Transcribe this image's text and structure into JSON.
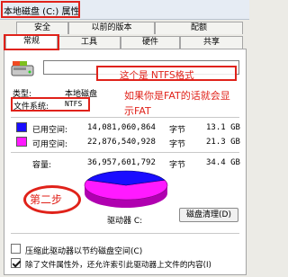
{
  "window": {
    "title": "本地磁盘 (C:) 属性"
  },
  "tabs": {
    "row1": [
      "安全",
      "以前的版本",
      "配额"
    ],
    "row2": [
      "常规",
      "工具",
      "硬件",
      "共享"
    ],
    "active": "常规"
  },
  "general": {
    "drive_name_value": "",
    "type_label": "类型:",
    "type_value": "本地磁盘",
    "fs_label": "文件系统:",
    "fs_value": "NTFS",
    "used_label": "已用空间:",
    "used_bytes": "14,081,060,864",
    "used_unit": "字节",
    "used_size": "13.1 GB",
    "free_label": "可用空间:",
    "free_bytes": "22,876,540,928",
    "free_unit": "字节",
    "free_size": "21.3 GB",
    "cap_label": "容量:",
    "cap_bytes": "36,957,601,792",
    "cap_unit": "字节",
    "cap_size": "34.4 GB",
    "drive_label": "驱动器 C:",
    "cleanup_button": "磁盘清理(D)",
    "compress_label": "压缩此驱动器以节约磁盘空间(C)",
    "compress_checked": false,
    "index_label": "除了文件属性外，还允许索引此驱动器上文件的内容(I)",
    "index_checked": true,
    "used_fraction": 0.381
  },
  "colors": {
    "used": "#1a0dff",
    "free": "#ff1aff",
    "annotation": "#e0221a"
  },
  "annotations": {
    "ntfs_note": "这个是 NTFS格式",
    "fat_note_line1": "如果你是FAT的话就会显",
    "fat_note_line2": "示FAT",
    "step_label": "第二步"
  },
  "icons": {
    "drive": "hard-drive-icon",
    "checkmark": "checkmark-icon"
  }
}
